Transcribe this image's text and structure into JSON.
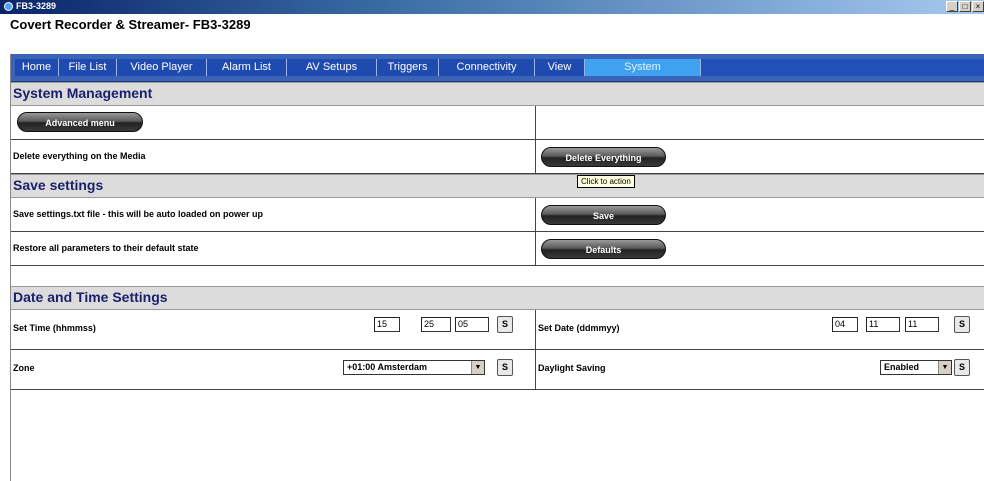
{
  "window": {
    "title": "FB3-3289"
  },
  "app": {
    "title": "Covert Recorder & Streamer- FB3-3289"
  },
  "nav": {
    "tabs": [
      "Home",
      "File List",
      "Video Player",
      "Alarm List",
      "AV Setups",
      "Triggers",
      "Connectivity",
      "View",
      "System"
    ],
    "active": "System"
  },
  "system_management": {
    "heading": "System Management",
    "advanced_button": "Advanced menu",
    "delete_label": "Delete everything on the Media",
    "delete_button": "Delete Everything",
    "tooltip": "Click to action"
  },
  "save_settings": {
    "heading": "Save settings",
    "save_label": "Save settings.txt file - this will be auto loaded on power up",
    "save_button": "Save",
    "restore_label": "Restore all parameters to their default state",
    "defaults_button": "Defaults"
  },
  "date_time": {
    "heading": "Date and Time Settings",
    "time_label": "Set Time (hhmmss)",
    "time_hh": "15",
    "time_mm": "25",
    "time_ss": "05",
    "date_label": "Set Date (ddmmyy)",
    "date_dd": "04",
    "date_mm": "11",
    "date_yy": "11",
    "set_button": "S",
    "zone_label": "Zone",
    "zone_value": "+01:00 Amsterdam",
    "dst_label": "Daylight Saving",
    "dst_value": "Enabled"
  },
  "colors": {
    "nav_bg": "#1f4bb0",
    "nav_active": "#3fa2f0",
    "heading_text": "#1a1f6b"
  },
  "icons": {
    "app": "app-icon",
    "minimize": "minimize-icon",
    "maximize": "maximize-icon",
    "close": "close-icon",
    "dropdown": "chevron-down-icon"
  }
}
